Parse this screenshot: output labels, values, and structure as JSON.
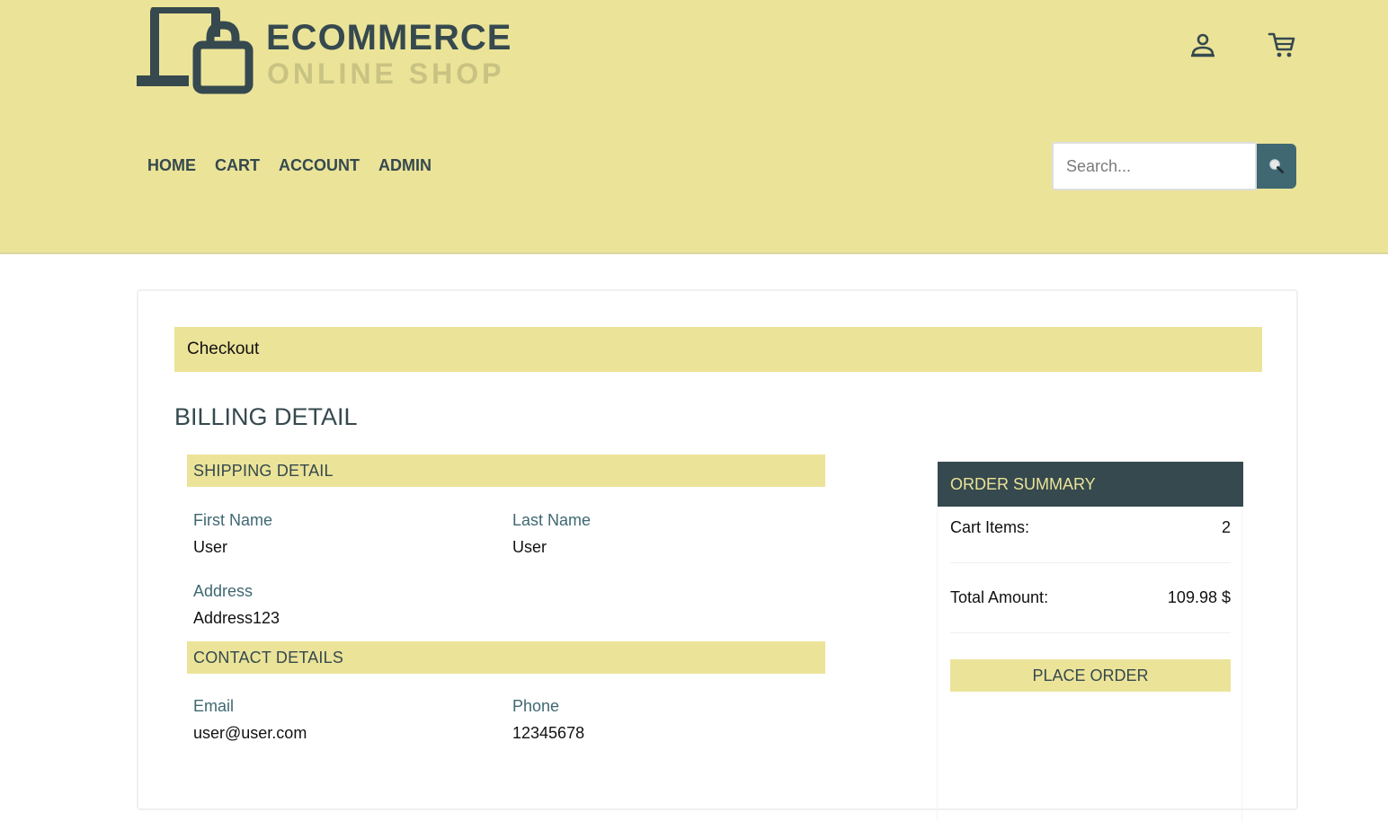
{
  "brand": {
    "title": "ECOMMERCE",
    "subtitle": "ONLINE SHOP",
    "logo_icon": "laptop-lock-icon"
  },
  "header": {
    "account_icon": "user-icon",
    "cart_icon": "cart-icon",
    "nav": [
      "HOME",
      "CART",
      "ACCOUNT",
      "ADMIN"
    ],
    "search": {
      "placeholder": "Search...",
      "value": "",
      "button_icon": "search-icon"
    }
  },
  "checkout": {
    "header": "Checkout",
    "billing_title": "BILLING DETAIL",
    "shipping": {
      "section_title": "SHIPPING DETAIL",
      "first_name_label": "First Name",
      "first_name": "User",
      "last_name_label": "Last Name",
      "last_name": "User",
      "address_label": "Address",
      "address": "Address123"
    },
    "contact": {
      "section_title": "CONTACT DETAILS",
      "email_label": "Email",
      "email": "user@user.com",
      "phone_label": "Phone",
      "phone": "12345678"
    }
  },
  "summary": {
    "title": "ORDER SUMMARY",
    "cart_items_label": "Cart Items:",
    "cart_items_value": "2",
    "total_label": "Total Amount:",
    "total_value": "109.98 $",
    "place_order_label": "PLACE ORDER"
  },
  "colors": {
    "header_bg": "#ebe398",
    "primary_dark": "#35494e",
    "accent_teal": "#3f6872",
    "muted_logo": "#c8c382"
  }
}
